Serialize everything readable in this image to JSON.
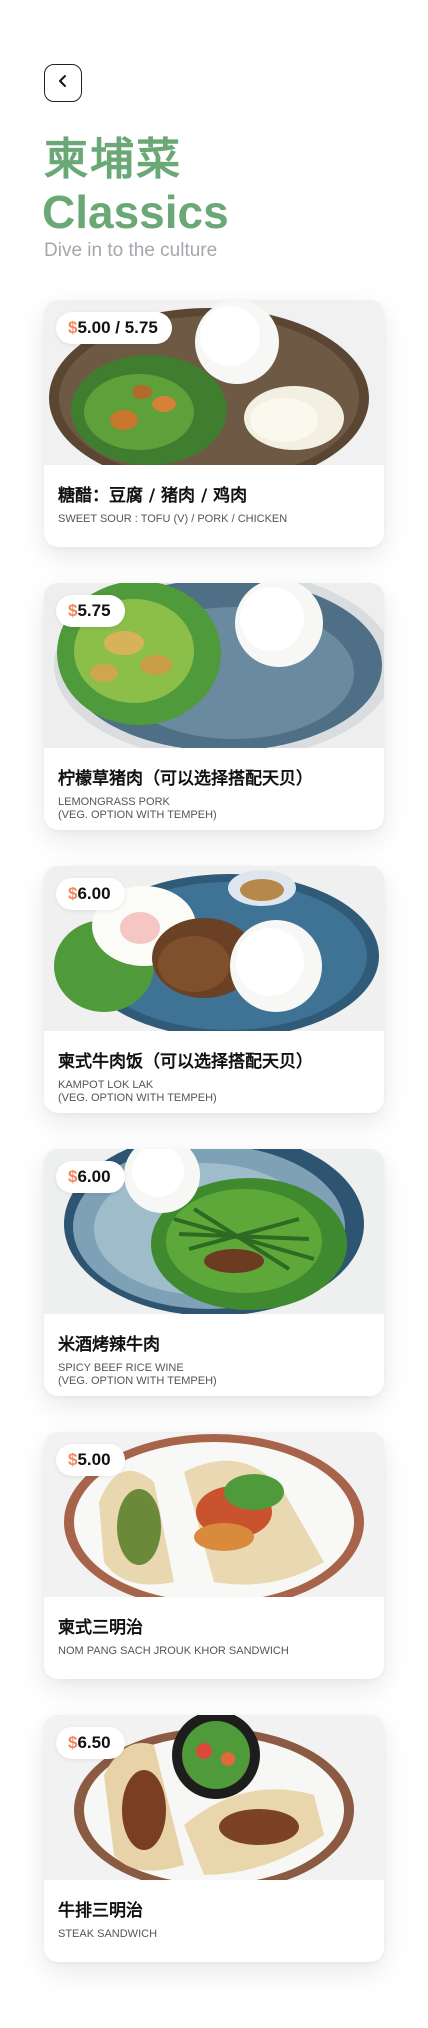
{
  "header": {
    "back_icon": "chevron-left-icon",
    "title_cn": "柬埔菜",
    "title_en": "Classics",
    "subtitle": "Dive in to the culture"
  },
  "colors": {
    "accent_green": "#6aa876",
    "price_currency": "#f08a5c",
    "subtitle_gray": "#a5a7ad"
  },
  "menu": [
    {
      "currency": "$",
      "price": "5.00 / 5.75",
      "name_cn": "糖醋：豆腐 / 猪肉 / 鸡肉",
      "name_en": [
        "SWEET SOUR : TOFU (V) / PORK / CHICKEN"
      ],
      "image": "sweet-sour-stir-fry-with-rice"
    },
    {
      "currency": "$",
      "price": "5.75",
      "name_cn": "柠檬草猪肉（可以选择搭配天贝）",
      "name_en": [
        "LEMONGRASS PORK",
        "(VEG. OPTION WITH TEMPEH)"
      ],
      "image": "lemongrass-pork-with-rice"
    },
    {
      "currency": "$",
      "price": "6.00",
      "name_cn": "柬式牛肉饭（可以选择搭配天贝）",
      "name_en": [
        "KAMPOT LOK LAK",
        "(VEG. OPTION WITH TEMPEH)"
      ],
      "image": "lok-lak-beef-egg-rice"
    },
    {
      "currency": "$",
      "price": "6.00",
      "name_cn": "米酒烤辣牛肉",
      "name_en": [
        "SPICY BEEF RICE WINE",
        "(VEG. OPTION WITH TEMPEH)"
      ],
      "image": "spicy-beef-green-beans-rice"
    },
    {
      "currency": "$",
      "price": "5.00",
      "name_cn": "柬式三明治",
      "name_en": [
        "NOM PANG SACH JROUK KHOR SANDWICH"
      ],
      "image": "khmer-baguette-sandwich"
    },
    {
      "currency": "$",
      "price": "6.50",
      "name_cn": "牛排三明治",
      "name_en": [
        "STEAK SANDWICH"
      ],
      "image": "steak-sandwich-with-salad"
    }
  ]
}
